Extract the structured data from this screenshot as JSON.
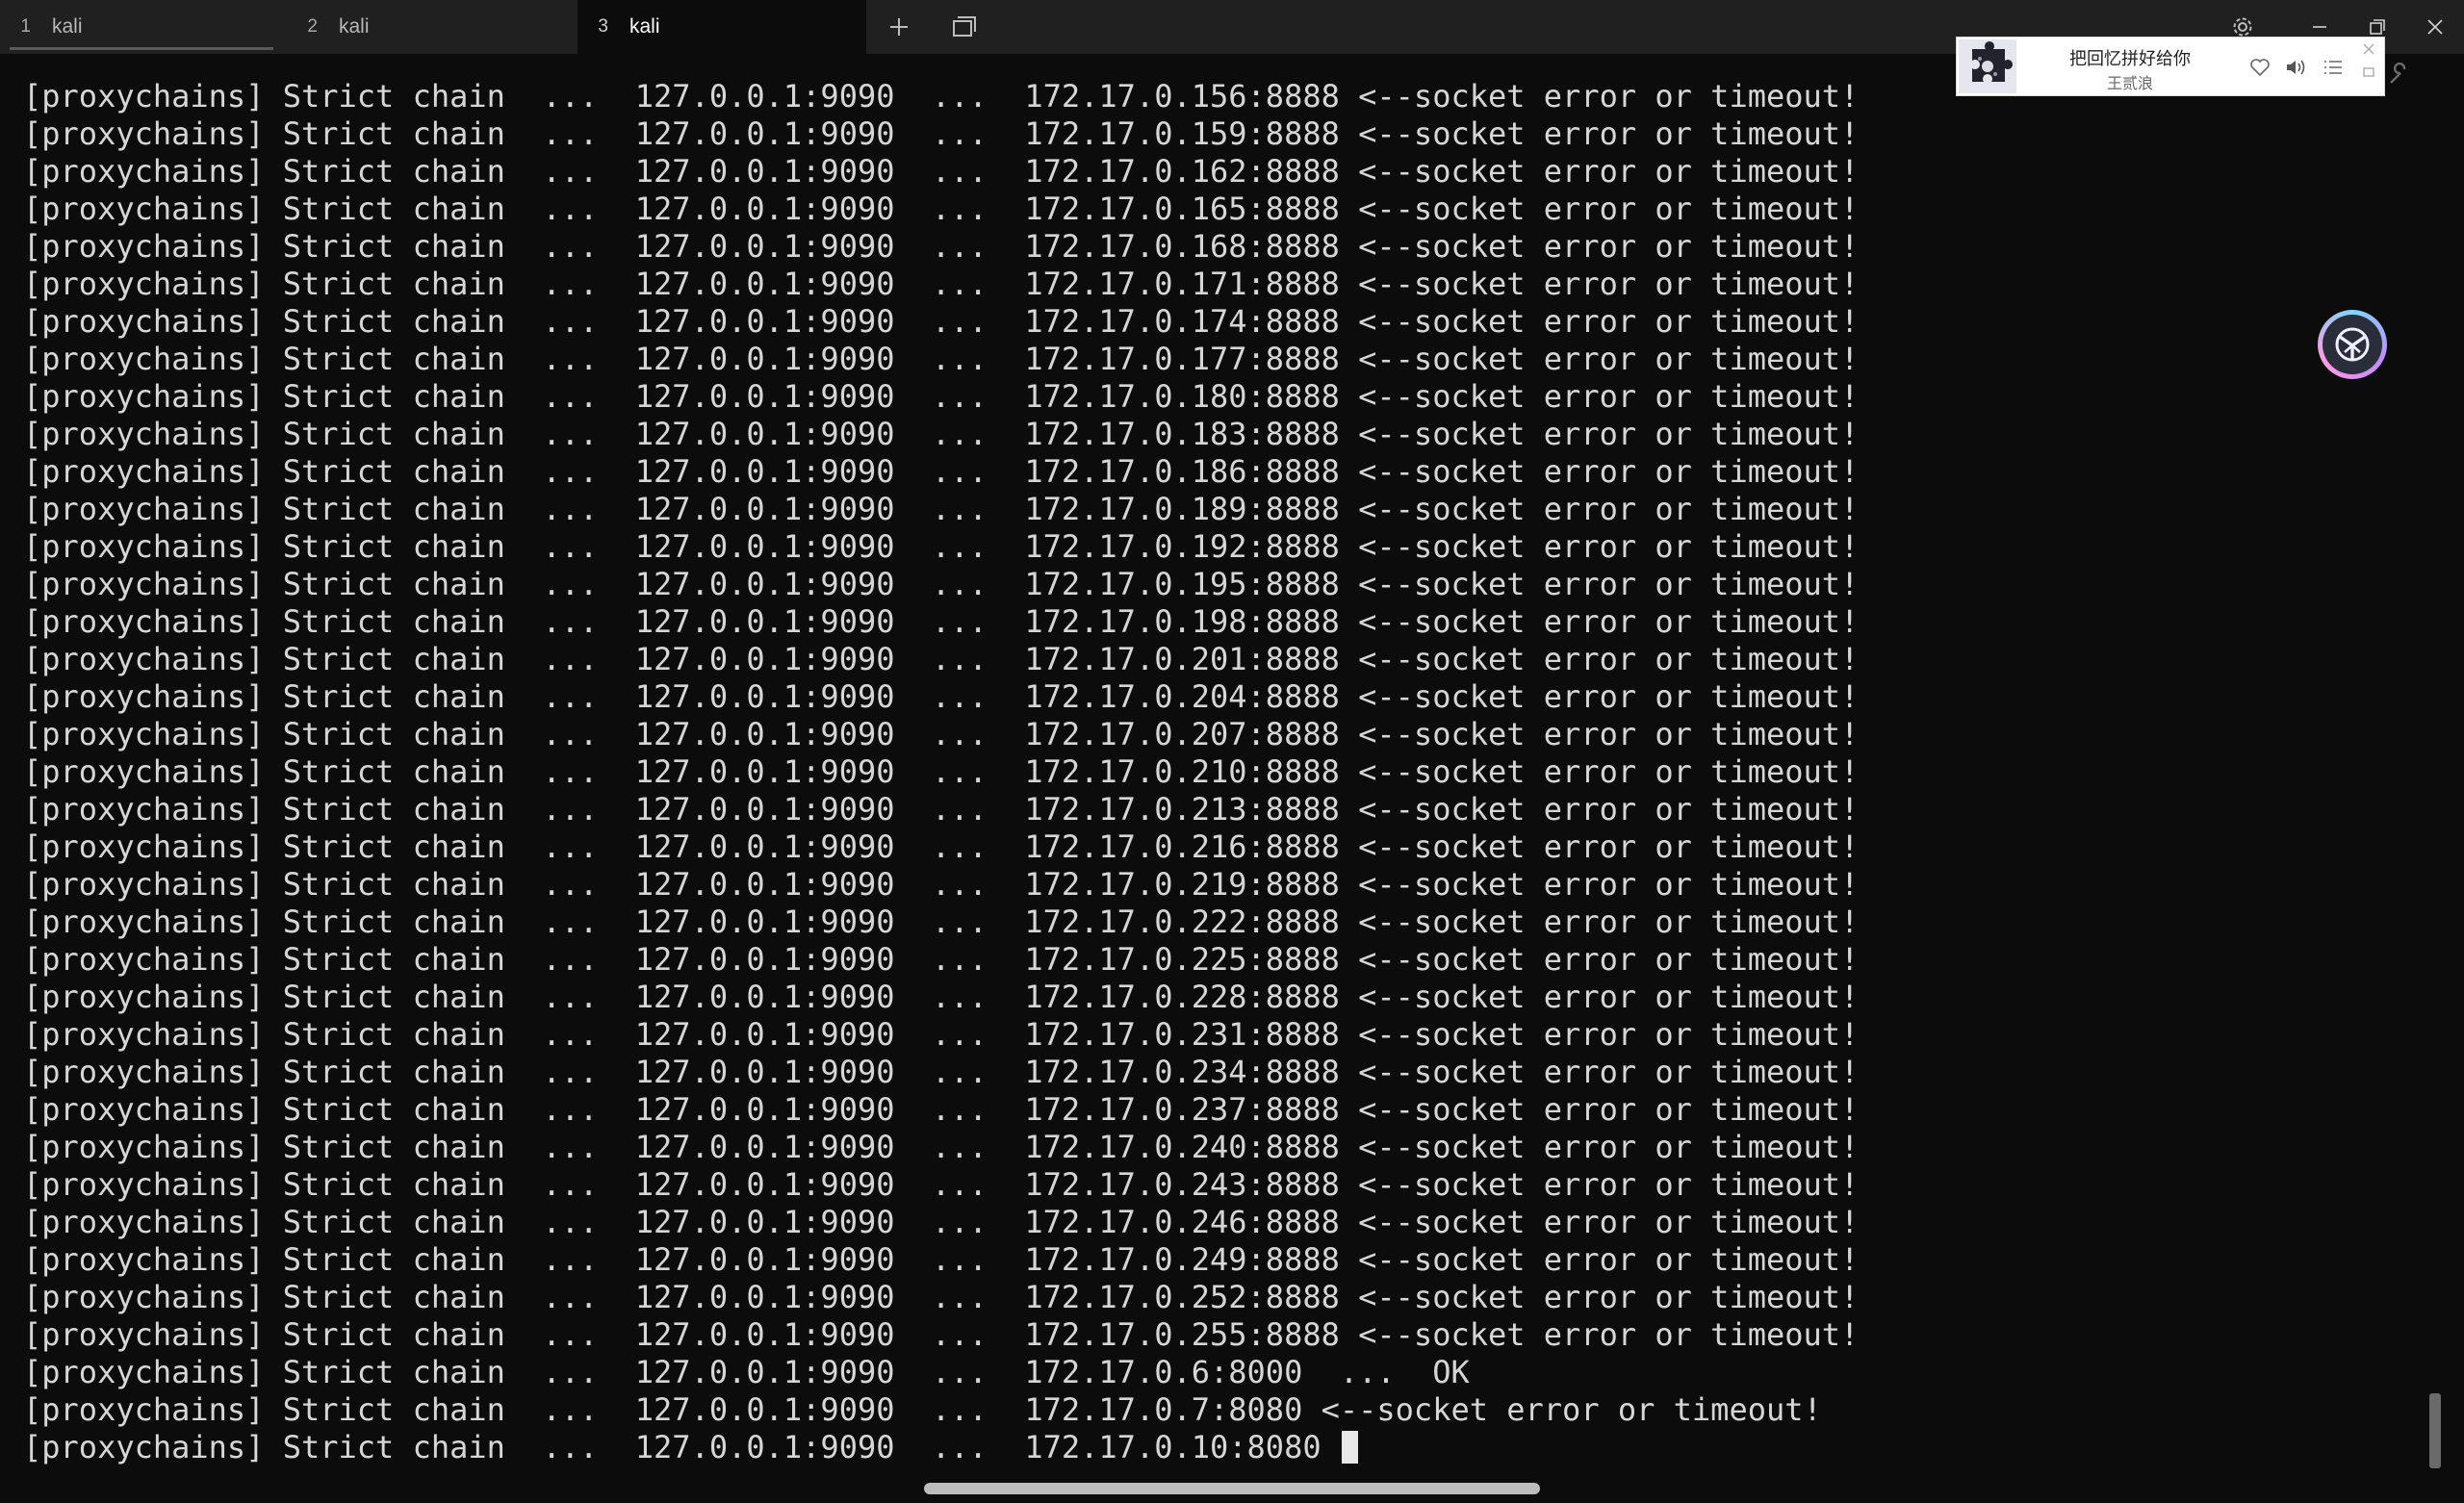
{
  "tabs": [
    {
      "number": "1",
      "title": "kali"
    },
    {
      "number": "2",
      "title": "kali"
    },
    {
      "number": "3",
      "title": "kali"
    }
  ],
  "active_tab": "3",
  "icons": {
    "new_tab": "plus-icon",
    "duplicate_tab": "window-icon",
    "settings": "gear-icon",
    "minimize": "minimize-icon",
    "maximize": "restore-icon",
    "close": "close-icon"
  },
  "terminal": {
    "lines": [
      "[proxychains] Strict chain  ...  127.0.0.1:9090  ...  172.17.0.156:8888 <--socket error or timeout!",
      "[proxychains] Strict chain  ...  127.0.0.1:9090  ...  172.17.0.159:8888 <--socket error or timeout!",
      "[proxychains] Strict chain  ...  127.0.0.1:9090  ...  172.17.0.162:8888 <--socket error or timeout!",
      "[proxychains] Strict chain  ...  127.0.0.1:9090  ...  172.17.0.165:8888 <--socket error or timeout!",
      "[proxychains] Strict chain  ...  127.0.0.1:9090  ...  172.17.0.168:8888 <--socket error or timeout!",
      "[proxychains] Strict chain  ...  127.0.0.1:9090  ...  172.17.0.171:8888 <--socket error or timeout!",
      "[proxychains] Strict chain  ...  127.0.0.1:9090  ...  172.17.0.174:8888 <--socket error or timeout!",
      "[proxychains] Strict chain  ...  127.0.0.1:9090  ...  172.17.0.177:8888 <--socket error or timeout!",
      "[proxychains] Strict chain  ...  127.0.0.1:9090  ...  172.17.0.180:8888 <--socket error or timeout!",
      "[proxychains] Strict chain  ...  127.0.0.1:9090  ...  172.17.0.183:8888 <--socket error or timeout!",
      "[proxychains] Strict chain  ...  127.0.0.1:9090  ...  172.17.0.186:8888 <--socket error or timeout!",
      "[proxychains] Strict chain  ...  127.0.0.1:9090  ...  172.17.0.189:8888 <--socket error or timeout!",
      "[proxychains] Strict chain  ...  127.0.0.1:9090  ...  172.17.0.192:8888 <--socket error or timeout!",
      "[proxychains] Strict chain  ...  127.0.0.1:9090  ...  172.17.0.195:8888 <--socket error or timeout!",
      "[proxychains] Strict chain  ...  127.0.0.1:9090  ...  172.17.0.198:8888 <--socket error or timeout!",
      "[proxychains] Strict chain  ...  127.0.0.1:9090  ...  172.17.0.201:8888 <--socket error or timeout!",
      "[proxychains] Strict chain  ...  127.0.0.1:9090  ...  172.17.0.204:8888 <--socket error or timeout!",
      "[proxychains] Strict chain  ...  127.0.0.1:9090  ...  172.17.0.207:8888 <--socket error or timeout!",
      "[proxychains] Strict chain  ...  127.0.0.1:9090  ...  172.17.0.210:8888 <--socket error or timeout!",
      "[proxychains] Strict chain  ...  127.0.0.1:9090  ...  172.17.0.213:8888 <--socket error or timeout!",
      "[proxychains] Strict chain  ...  127.0.0.1:9090  ...  172.17.0.216:8888 <--socket error or timeout!",
      "[proxychains] Strict chain  ...  127.0.0.1:9090  ...  172.17.0.219:8888 <--socket error or timeout!",
      "[proxychains] Strict chain  ...  127.0.0.1:9090  ...  172.17.0.222:8888 <--socket error or timeout!",
      "[proxychains] Strict chain  ...  127.0.0.1:9090  ...  172.17.0.225:8888 <--socket error or timeout!",
      "[proxychains] Strict chain  ...  127.0.0.1:9090  ...  172.17.0.228:8888 <--socket error or timeout!",
      "[proxychains] Strict chain  ...  127.0.0.1:9090  ...  172.17.0.231:8888 <--socket error or timeout!",
      "[proxychains] Strict chain  ...  127.0.0.1:9090  ...  172.17.0.234:8888 <--socket error or timeout!",
      "[proxychains] Strict chain  ...  127.0.0.1:9090  ...  172.17.0.237:8888 <--socket error or timeout!",
      "[proxychains] Strict chain  ...  127.0.0.1:9090  ...  172.17.0.240:8888 <--socket error or timeout!",
      "[proxychains] Strict chain  ...  127.0.0.1:9090  ...  172.17.0.243:8888 <--socket error or timeout!",
      "[proxychains] Strict chain  ...  127.0.0.1:9090  ...  172.17.0.246:8888 <--socket error or timeout!",
      "[proxychains] Strict chain  ...  127.0.0.1:9090  ...  172.17.0.249:8888 <--socket error or timeout!",
      "[proxychains] Strict chain  ...  127.0.0.1:9090  ...  172.17.0.252:8888 <--socket error or timeout!",
      "[proxychains] Strict chain  ...  127.0.0.1:9090  ...  172.17.0.255:8888 <--socket error or timeout!",
      "[proxychains] Strict chain  ...  127.0.0.1:9090  ...  172.17.0.6:8000  ...  OK",
      "[proxychains] Strict chain  ...  127.0.0.1:9090  ...  172.17.0.7:8080 <--socket error or timeout!"
    ],
    "prompt_line": "[proxychains] Strict chain  ...  127.0.0.1:9090  ...  172.17.0.10:8080 "
  },
  "music_player": {
    "song_title": "把回忆拼好给你",
    "artist": "王贰浪",
    "icons": [
      "album-art",
      "heart-icon",
      "volume-icon",
      "playlist-icon",
      "close-icon",
      "mini-icon"
    ]
  },
  "floating_button": {
    "icon": "assistant-logo-icon"
  },
  "colors": {
    "terminal_background": "#0c0c0c",
    "terminal_text": "#d6d6d6",
    "tabbar_background": "#202020"
  }
}
